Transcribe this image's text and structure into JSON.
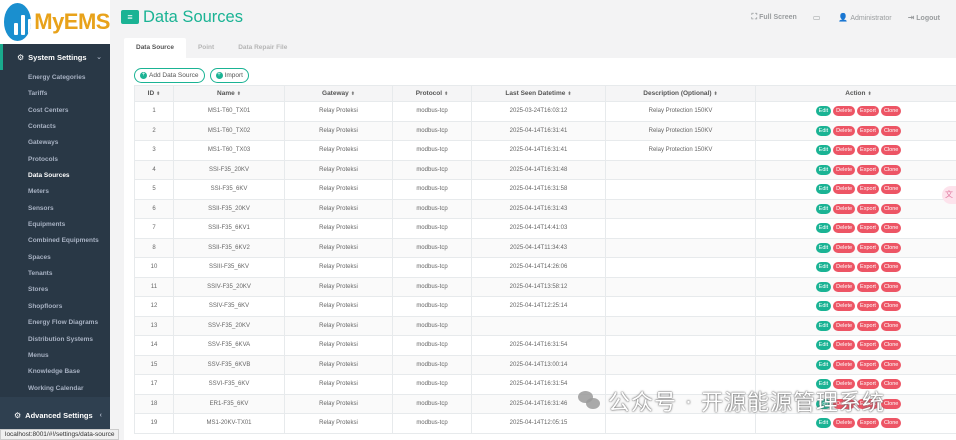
{
  "brand": {
    "name": "MyEMS"
  },
  "sidebar": {
    "group1": {
      "label": "System Settings"
    },
    "items": [
      {
        "label": "Energy Categories",
        "active": false
      },
      {
        "label": "Tariffs",
        "active": false
      },
      {
        "label": "Cost Centers",
        "active": false
      },
      {
        "label": "Contacts",
        "active": false
      },
      {
        "label": "Gateways",
        "active": false
      },
      {
        "label": "Protocols",
        "active": false
      },
      {
        "label": "Data Sources",
        "active": true
      },
      {
        "label": "Meters",
        "active": false
      },
      {
        "label": "Sensors",
        "active": false
      },
      {
        "label": "Equipments",
        "active": false
      },
      {
        "label": "Combined Equipments",
        "active": false
      },
      {
        "label": "Spaces",
        "active": false
      },
      {
        "label": "Tenants",
        "active": false
      },
      {
        "label": "Stores",
        "active": false
      },
      {
        "label": "Shopfloors",
        "active": false
      },
      {
        "label": "Energy Flow Diagrams",
        "active": false
      },
      {
        "label": "Distribution Systems",
        "active": false
      },
      {
        "label": "Menus",
        "active": false
      },
      {
        "label": "Knowledge Base",
        "active": false
      },
      {
        "label": "Working Calendar",
        "active": false
      }
    ],
    "group2": {
      "label": "Advanced Settings"
    }
  },
  "header": {
    "title": "Data Sources",
    "full_screen": "Full Screen",
    "user": "Administrator",
    "logout": "Logout"
  },
  "tabs": [
    {
      "label": "Data Source",
      "active": true
    },
    {
      "label": "Point",
      "active": false
    },
    {
      "label": "Data Repair File",
      "active": false
    }
  ],
  "toolbar": {
    "add_label": "Add Data Source",
    "import_label": "Import"
  },
  "table": {
    "columns": [
      "ID",
      "Name",
      "Gateway",
      "Protocol",
      "Last Seen Datetime",
      "Description (Optional)",
      "Action"
    ],
    "rows": [
      {
        "id": "1",
        "name": "MS1-T60_TX01",
        "gateway": "Relay Proteksi",
        "protocol": "modbus-tcp",
        "last_seen": "2025-03-24T16:03:12",
        "description": "Relay Protection 150KV"
      },
      {
        "id": "2",
        "name": "MS1-T60_TX02",
        "gateway": "Relay Proteksi",
        "protocol": "modbus-tcp",
        "last_seen": "2025-04-14T16:31:41",
        "description": "Relay Protection 150KV"
      },
      {
        "id": "3",
        "name": "MS1-T60_TX03",
        "gateway": "Relay Proteksi",
        "protocol": "modbus-tcp",
        "last_seen": "2025-04-14T16:31:41",
        "description": "Relay Protection 150KV"
      },
      {
        "id": "4",
        "name": "SSI-F35_20KV",
        "gateway": "Relay Proteksi",
        "protocol": "modbus-tcp",
        "last_seen": "2025-04-14T16:31:48",
        "description": ""
      },
      {
        "id": "5",
        "name": "SSI-F35_6KV",
        "gateway": "Relay Proteksi",
        "protocol": "modbus-tcp",
        "last_seen": "2025-04-14T16:31:58",
        "description": ""
      },
      {
        "id": "6",
        "name": "SSII-F35_20KV",
        "gateway": "Relay Proteksi",
        "protocol": "modbus-tcp",
        "last_seen": "2025-04-14T16:31:43",
        "description": ""
      },
      {
        "id": "7",
        "name": "SSII-F35_6KV1",
        "gateway": "Relay Proteksi",
        "protocol": "modbus-tcp",
        "last_seen": "2025-04-14T14:41:03",
        "description": ""
      },
      {
        "id": "8",
        "name": "SSII-F35_6KV2",
        "gateway": "Relay Proteksi",
        "protocol": "modbus-tcp",
        "last_seen": "2025-04-14T11:34:43",
        "description": ""
      },
      {
        "id": "10",
        "name": "SSIII-F35_6KV",
        "gateway": "Relay Proteksi",
        "protocol": "modbus-tcp",
        "last_seen": "2025-04-14T14:26:06",
        "description": ""
      },
      {
        "id": "11",
        "name": "SSIV-F35_20KV",
        "gateway": "Relay Proteksi",
        "protocol": "modbus-tcp",
        "last_seen": "2025-04-14T13:58:12",
        "description": ""
      },
      {
        "id": "12",
        "name": "SSIV-F35_6KV",
        "gateway": "Relay Proteksi",
        "protocol": "modbus-tcp",
        "last_seen": "2025-04-14T12:25:14",
        "description": ""
      },
      {
        "id": "13",
        "name": "SSV-F35_20KV",
        "gateway": "Relay Proteksi",
        "protocol": "modbus-tcp",
        "last_seen": "",
        "description": ""
      },
      {
        "id": "14",
        "name": "SSV-F35_6KVA",
        "gateway": "Relay Proteksi",
        "protocol": "modbus-tcp",
        "last_seen": "2025-04-14T16:31:54",
        "description": ""
      },
      {
        "id": "15",
        "name": "SSV-F35_6KVB",
        "gateway": "Relay Proteksi",
        "protocol": "modbus-tcp",
        "last_seen": "2025-04-14T13:00:14",
        "description": ""
      },
      {
        "id": "17",
        "name": "SSVI-F35_6KV",
        "gateway": "Relay Proteksi",
        "protocol": "modbus-tcp",
        "last_seen": "2025-04-14T16:31:54",
        "description": ""
      },
      {
        "id": "18",
        "name": "ER1-F35_6KV",
        "gateway": "Relay Proteksi",
        "protocol": "modbus-tcp",
        "last_seen": "2025-04-14T16:31:46",
        "description": ""
      },
      {
        "id": "19",
        "name": "MS1-20KV-TX01",
        "gateway": "Relay Proteksi",
        "protocol": "modbus-tcp",
        "last_seen": "2025-04-14T12:05:15",
        "description": ""
      }
    ],
    "action_labels": {
      "edit": "Edit",
      "delete": "Delete",
      "export": "Export",
      "clone": "Clone"
    }
  },
  "status_bar": {
    "url": "localhost:8001/#!/settings/data-source"
  },
  "watermark": {
    "text": "公众号 · 开源能源管理系统"
  },
  "colors": {
    "accent": "#1ab394",
    "danger": "#ed5565",
    "sidebar": "#2f4050",
    "brand_text": "#e8a21a",
    "logo_blue": "#1a8fcf"
  }
}
